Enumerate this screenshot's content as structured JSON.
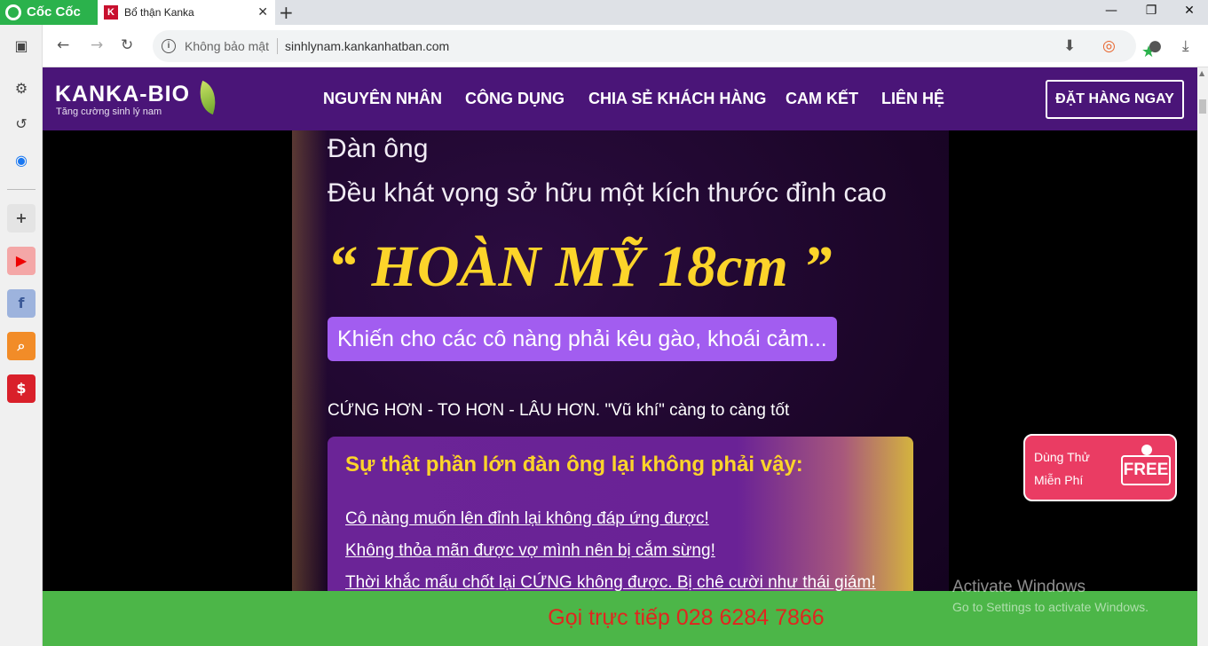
{
  "browser": {
    "brand": "Cốc Cốc",
    "tab_favicon": "K",
    "tab_title": "Bổ thận Kanka",
    "tab_close": "✕",
    "new_tab": "+",
    "window": {
      "minimize": "—",
      "maximize": "❐",
      "close": "✕"
    },
    "address": {
      "security_label": "Không bảo mật",
      "url": "sinhlynam.kankanhatban.com"
    }
  },
  "site": {
    "logo": "KANKA-BIO",
    "logo_tagline": "Tăng cường sinh lý nam",
    "nav": [
      "NGUYÊN NHÂN",
      "CÔNG DỤNG",
      "CHIA SẺ KHÁCH HÀNG",
      "CAM KẾT",
      "LIÊN HỆ"
    ],
    "order_button": "ĐẶT HÀNG NGAY"
  },
  "hero": {
    "line1": "Đàn ông",
    "line2": "Đều khát vọng sở hữu một kích thước đỉnh cao",
    "headline": "“ HOÀN MỸ 18cm ”",
    "pill": "Khiến cho các cô nàng phải kêu gào, khoái cảm...",
    "tagline": "CỨNG HƠN - TO HƠN - LÂU HƠN. \"Vũ khí\" càng to càng tốt",
    "truth_title": "Sự thật phần lớn đàn ông lại không phải vậy:",
    "truth_items": [
      "Cô nàng muốn lên đỉnh lại không đáp ứng được!",
      "Không thỏa mãn được vợ mình nên bị cắm sừng!",
      "Thời khắc mấu chốt lại CỨNG không được. Bị chê cười như thái giám!"
    ]
  },
  "free_trial": {
    "line1": "Dùng Thử",
    "line2": "Miễn Phí",
    "badge": "FREE"
  },
  "call_bar": "Gọi trực tiếp  028 6284 7866",
  "watermark": {
    "title": "Activate Windows",
    "subtitle": "Go to Settings to activate Windows."
  },
  "colors": {
    "nav_bg": "#4a1578",
    "accent_yellow": "#fcd42a",
    "pill": "#a25df0",
    "call_bg": "#4cb648",
    "call_text": "#e0261f",
    "free_bg": "#ea3c63"
  }
}
